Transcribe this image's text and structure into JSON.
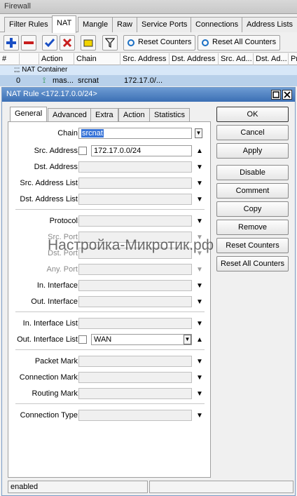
{
  "window": {
    "title": "Firewall"
  },
  "tabs": [
    "Filter Rules",
    "NAT",
    "Mangle",
    "Raw",
    "Service Ports",
    "Connections",
    "Address Lists"
  ],
  "toolbar": {
    "reset_counters": "Reset Counters",
    "reset_all_counters": "Reset All Counters"
  },
  "table": {
    "headers": [
      "#",
      "Action",
      "Chain",
      "Src. Address",
      "Dst. Address",
      "Src. Ad...",
      "Dst. Ad...",
      "Pr"
    ],
    "group": ";;; NAT Container",
    "row": {
      "num": "0",
      "action": "mas...",
      "chain": "srcnat",
      "src": "172.17.0/..."
    }
  },
  "dialog": {
    "title": "NAT Rule <172.17.0.0/24>",
    "subtabs": [
      "General",
      "Advanced",
      "Extra",
      "Action",
      "Statistics"
    ],
    "fields": {
      "chain": {
        "label": "Chain:",
        "value": "srcnat"
      },
      "src_address": {
        "label": "Src. Address:",
        "value": "172.17.0.0/24"
      },
      "dst_address": {
        "label": "Dst. Address:"
      },
      "src_address_list": {
        "label": "Src. Address List:"
      },
      "dst_address_list": {
        "label": "Dst. Address List:"
      },
      "protocol": {
        "label": "Protocol:"
      },
      "src_port": {
        "label": "Src. Port:"
      },
      "dst_port": {
        "label": "Dst. Port:"
      },
      "any_port": {
        "label": "Any. Port:"
      },
      "in_interface": {
        "label": "In. Interface:"
      },
      "out_interface": {
        "label": "Out. Interface:"
      },
      "in_interface_list": {
        "label": "In. Interface List:"
      },
      "out_interface_list": {
        "label": "Out. Interface List:",
        "value": "WAN"
      },
      "packet_mark": {
        "label": "Packet Mark:"
      },
      "connection_mark": {
        "label": "Connection Mark:"
      },
      "routing_mark": {
        "label": "Routing Mark:"
      },
      "connection_type": {
        "label": "Connection Type:"
      }
    },
    "buttons": [
      "OK",
      "Cancel",
      "Apply",
      "Disable",
      "Comment",
      "Copy",
      "Remove",
      "Reset Counters",
      "Reset All Counters"
    ],
    "status": "enabled"
  },
  "watermark": "Настройка-Микротик.рф"
}
